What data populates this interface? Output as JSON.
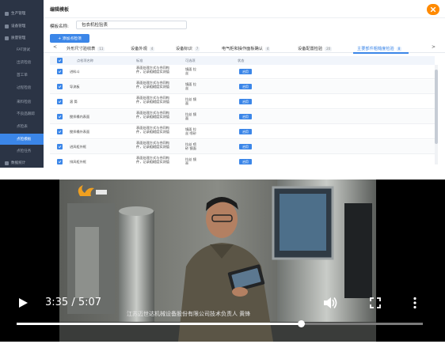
{
  "sidebar": {
    "items": [
      {
        "label": "生产管理",
        "sub": false,
        "active": false
      },
      {
        "label": "设备管理",
        "sub": false,
        "active": false
      },
      {
        "label": "质量管理",
        "sub": false,
        "active": false
      },
      {
        "label": "FAT测试",
        "sub": true,
        "active": false
      },
      {
        "label": "出货检验",
        "sub": true,
        "active": false
      },
      {
        "label": "首工单",
        "sub": true,
        "active": false
      },
      {
        "label": "过程检验",
        "sub": true,
        "active": false
      },
      {
        "label": "来料检验",
        "sub": true,
        "active": false
      },
      {
        "label": "不良品跟踪",
        "sub": true,
        "active": false
      },
      {
        "label": "点检表",
        "sub": true,
        "active": false
      },
      {
        "label": "点检模板",
        "sub": true,
        "active": true
      },
      {
        "label": "点检任务",
        "sub": true,
        "active": false
      },
      {
        "label": "数据统计",
        "sub": false,
        "active": false
      }
    ]
  },
  "header": {
    "title": "编辑模板"
  },
  "form": {
    "name_label": "模板名称:",
    "name_value": "包衣机检验表"
  },
  "toolbar": {
    "add_label": "+ 添加点检项"
  },
  "tabs": {
    "prev": "<",
    "next": ">",
    "items": [
      {
        "label": "外形尺寸验收表",
        "count": "11",
        "active": false
      },
      {
        "label": "设备外观",
        "count": "4",
        "active": false
      },
      {
        "label": "设备标识",
        "count": "7",
        "active": false
      },
      {
        "label": "电气柜和操作面板确认",
        "count": "4",
        "active": false
      },
      {
        "label": "设备配置检验",
        "count": "20",
        "active": false
      },
      {
        "label": "主要部件粗糙度检验",
        "count": "8",
        "active": true
      }
    ]
  },
  "table": {
    "headers": [
      "点检项名称",
      "标准",
      "可选项",
      "状态"
    ],
    "rows": [
      {
        "name": "进料斗",
        "standard": "表面处理方式与合同构件，记录粗糙度实测值",
        "options": "镜面 拉丝",
        "status": "启用"
      },
      {
        "name": "导流板",
        "standard": "表面处理方式与合同构件，记录粗糙度实测值",
        "options": "镜面 拉丝",
        "status": "启用"
      },
      {
        "name": "滚 筒",
        "standard": "表面处理方式与合同构件，记录粗糙度实测值",
        "options": "拉丝 镜面",
        "status": "启用"
      },
      {
        "name": "搅拌桶内表面",
        "standard": "表面处理方式与合同构件，记录粗糙度实测值",
        "options": "拉丝 镜面",
        "status": "启用"
      },
      {
        "name": "搅拌桶外表面",
        "standard": "表面处理方式与合同构件，记录粗糙度实测值",
        "options": "镜面 拉丝 喷砂",
        "status": "启用"
      },
      {
        "name": "进风柜外框",
        "standard": "表面处理方式与合同构件，记录粗糙度实测值",
        "options": "拉丝 喷砂 镜面",
        "status": "启用"
      },
      {
        "name": "排风柜外框",
        "standard": "表面处理方式与合同构件，记录粗糙度实测值",
        "options": "拉丝 镜面",
        "status": "启用"
      }
    ]
  },
  "video": {
    "time_display": "3:35 / 5:07",
    "progress_fraction": 0.7,
    "caption": "江苏迈世达机械设备股份有限公司技术负责人 黄锋"
  },
  "colors": {
    "sidebar_bg": "#2b3445",
    "accent": "#3b86e8",
    "close_orange": "#ff8a00"
  },
  "icons": {
    "close": "close-icon",
    "check": "check-icon",
    "play": "play-icon",
    "volume": "volume-icon",
    "fullscreen": "fullscreen-icon",
    "more": "more-vertical-icon"
  }
}
